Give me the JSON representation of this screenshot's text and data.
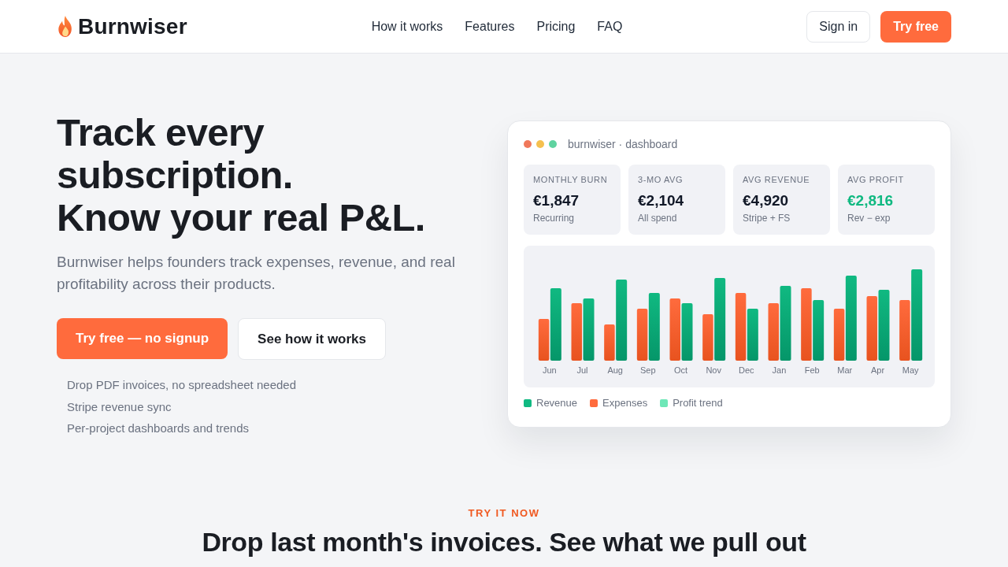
{
  "header": {
    "brand": "Burnwiser",
    "nav": [
      "How it works",
      "Features",
      "Pricing",
      "FAQ"
    ],
    "sign_in": "Sign in",
    "cta": "Try free"
  },
  "hero": {
    "title_lines": [
      "Track every subscription.",
      "Know your real P&L."
    ],
    "subtitle": "Burnwiser helps founders track expenses, revenue, and real profitability across their products.",
    "primary_button": "Try free — no signup",
    "secondary_button": "See how it works",
    "bullets": [
      "Drop PDF invoices, no spreadsheet needed",
      "Stripe revenue sync",
      "Per-project dashboards and trends"
    ]
  },
  "dashboard": {
    "dots": [
      {
        "color": "#f0785a"
      },
      {
        "color": "#f5c04f"
      },
      {
        "color": "#5fd3a0"
      }
    ],
    "title": "burnwiser · dashboard",
    "stats": [
      {
        "label": "MONTHLY BURN",
        "value": "€1,847",
        "note": "Recurring",
        "positive": false
      },
      {
        "label": "3-MO AVG",
        "value": "€2,104",
        "note": "All spend",
        "positive": false
      },
      {
        "label": "AVG REVENUE",
        "value": "€4,920",
        "note": "Stripe + FS",
        "positive": false
      },
      {
        "label": "AVG PROFIT",
        "value": "€2,816",
        "note": "Rev − exp",
        "positive": true
      }
    ],
    "months": [
      "Jun",
      "Jul",
      "Aug",
      "Sep",
      "Oct",
      "Nov",
      "Dec",
      "Jan",
      "Feb",
      "Mar",
      "Apr",
      "May"
    ],
    "legend": [
      {
        "label": "Revenue",
        "color": "#10b981"
      },
      {
        "label": "Expenses",
        "color": "#ff6b3d"
      },
      {
        "label": "Profit trend",
        "color": "#6ee7b7"
      }
    ]
  },
  "try_section": {
    "eyebrow": "TRY IT NOW",
    "heading": "Drop last month's invoices. See what we pull out"
  }
}
